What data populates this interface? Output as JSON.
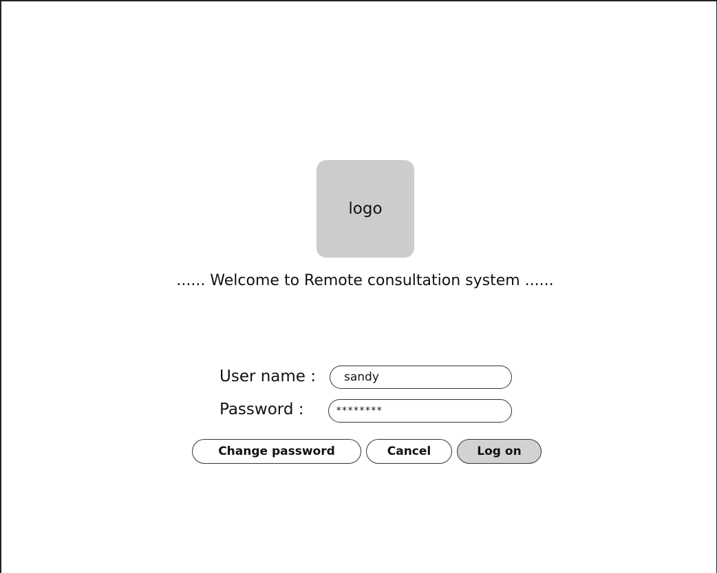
{
  "logo": {
    "text": "logo"
  },
  "welcome": {
    "text": "...... Welcome to Remote consultation system ......"
  },
  "login_form": {
    "username_label": "User name :",
    "username_value": "sandy",
    "password_label": "Password :",
    "password_value": "********"
  },
  "buttons": {
    "change_password": "Change password",
    "cancel": "Cancel",
    "log_on": "Log on"
  },
  "colors": {
    "logo_background": "#cccccc",
    "primary_button_background": "#d2d2d2",
    "border": "#333333"
  }
}
